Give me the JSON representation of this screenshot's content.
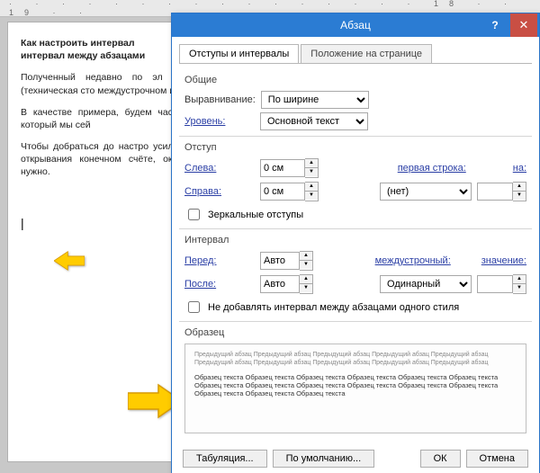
{
  "ruler": "· · · · · · · · · · · · · · · · 18 · · 19 · ·",
  "doc": {
    "p1": "Как настроить интервал",
    "p1b": "интервал между абзацами",
    "p2": "Полученный недавно по эл документа (техническая сто междустрочном интервале.",
    "p3": "В качестве примера, будем часть текста, который мы сей",
    "p4": "Чтобы добраться до настро усилия в виде открывания конечном счёте, оказаться в нужно."
  },
  "dialog": {
    "title": "Абзац",
    "tabs": {
      "t1": "Отступы и интервалы",
      "t2": "Положение на странице"
    },
    "g_general": "Общие",
    "align_lbl": "Выравнивание:",
    "align_val": "По ширине",
    "level_lbl": "Уровень:",
    "level_val": "Основной текст",
    "g_indent": "Отступ",
    "left_lbl": "Слева:",
    "left_val": "0 см",
    "right_lbl": "Справа:",
    "right_val": "0 см",
    "first_lbl": "первая строка:",
    "first_val": "(нет)",
    "on_lbl": "на:",
    "on_val": "",
    "mirror": "Зеркальные отступы",
    "g_interval": "Интервал",
    "before_lbl": "Перед:",
    "before_val": "Авто",
    "after_lbl": "После:",
    "after_val": "Авто",
    "line_lbl": "междустрочный:",
    "line_val": "Одинарный",
    "value_lbl": "значение:",
    "value_val": "",
    "noadd": "Не добавлять интервал между абзацами одного стиля",
    "g_sample": "Образец",
    "prev_light": "Предыдущий абзац Предыдущий абзац Предыдущий абзац Предыдущий абзац Предыдущий абзац Предыдущий абзац Предыдущий абзац Предыдущий абзац Предыдущий абзац Предыдущий абзац",
    "prev_dark": "Образец текста Образец текста Образец текста Образец текста Образец текста Образец текста Образец текста Образец текста Образец текста Образец текста Образец текста Образец текста Образец текста Образец текста Образец текста",
    "btn_tab": "Табуляция...",
    "btn_def": "По умолчанию...",
    "btn_ok": "ОК",
    "btn_cancel": "Отмена"
  }
}
